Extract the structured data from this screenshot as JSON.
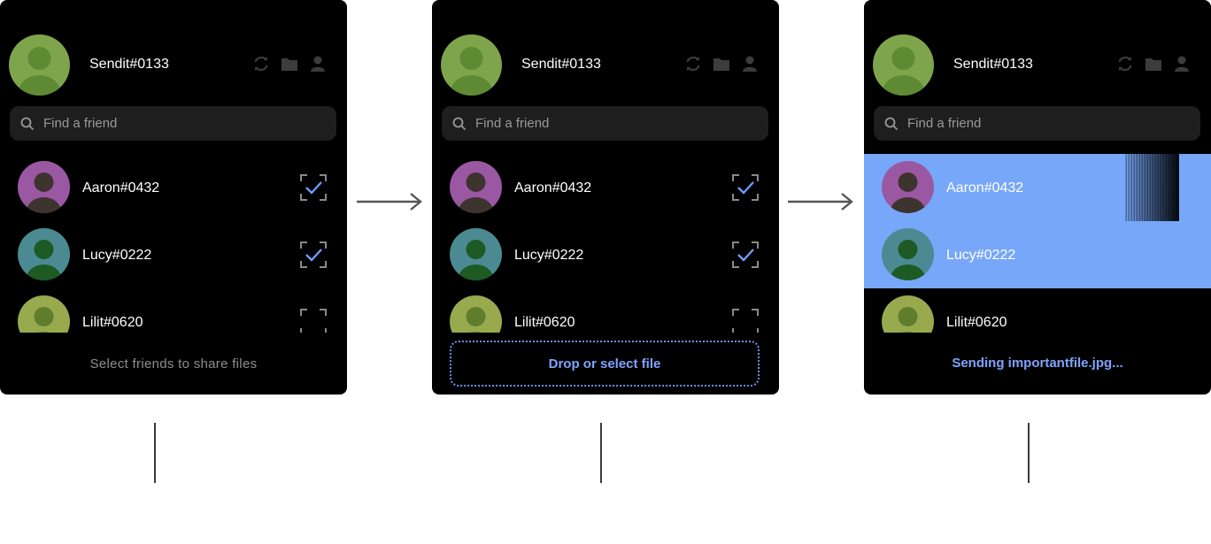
{
  "panels": [
    {
      "username": "Sendit#0133",
      "search_placeholder": "Find a friend",
      "friends": [
        {
          "name": "Aaron#0432",
          "checked": true
        },
        {
          "name": "Lucy#0222",
          "checked": true
        },
        {
          "name": "Lilit#0620",
          "checked": false
        }
      ],
      "footer": "Select friends to share files"
    },
    {
      "username": "Sendit#0133",
      "search_placeholder": "Find a friend",
      "friends": [
        {
          "name": "Aaron#0432",
          "checked": true
        },
        {
          "name": "Lucy#0222",
          "checked": true
        },
        {
          "name": "Lilit#0620",
          "checked": false
        }
      ],
      "dropzone": "Drop or select file"
    },
    {
      "username": "Sendit#0133",
      "search_placeholder": "Find a friend",
      "friends": [
        {
          "name": "Aaron#0432",
          "highlighted": true
        },
        {
          "name": "Lucy#0222",
          "highlighted": true
        },
        {
          "name": "Lilit#0620",
          "highlighted": false
        }
      ],
      "status": "Sending importantfile.jpg..."
    }
  ],
  "header_icons": [
    "refresh-icon",
    "folder-icon",
    "profile-icon"
  ],
  "avatar_colors": {
    "self": "#7fa54c",
    "Aaron#0432": "#9a58a3",
    "Lucy#0222": "#4b8a92",
    "Lilit#0620": "#98a94e"
  },
  "colors": {
    "accent": "#77a7f8",
    "check": "#6f9bff",
    "panel_bg": "#000000"
  }
}
